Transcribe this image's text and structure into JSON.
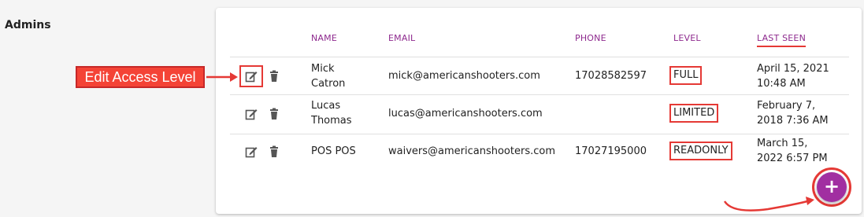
{
  "section": {
    "title": "Admins"
  },
  "table": {
    "headers": {
      "name": "NAME",
      "email": "EMAIL",
      "phone": "PHONE",
      "level": "LEVEL",
      "last_seen": "LAST SEEN"
    },
    "rows": [
      {
        "name_line1": "Mick",
        "name_line2": "Catron",
        "email": "mick@americanshooters.com",
        "phone": "17028582597",
        "level": "FULL",
        "last_seen_line1": "April 15, 2021",
        "last_seen_line2": "10:48 AM"
      },
      {
        "name_line1": "Lucas",
        "name_line2": "Thomas",
        "email": "lucas@americanshooters.com",
        "phone": "",
        "level": "LIMITED",
        "last_seen_line1": "February 7,",
        "last_seen_line2": "2018 7:36 AM"
      },
      {
        "name_line1": "POS POS",
        "name_line2": "",
        "email": "waivers@americanshooters.com",
        "phone": "17027195000",
        "level": "READONLY",
        "last_seen_line1": "March 15,",
        "last_seen_line2": "2022 6:57 PM"
      }
    ]
  },
  "annotation": {
    "callout_text": "Edit Access Level"
  },
  "fab": {
    "label": "+"
  },
  "colors": {
    "header_text": "#8e2a8e",
    "annotation_red": "#e53935",
    "fab": "#a12fa1"
  },
  "icons": [
    "edit-icon",
    "trash-icon",
    "plus-icon"
  ]
}
